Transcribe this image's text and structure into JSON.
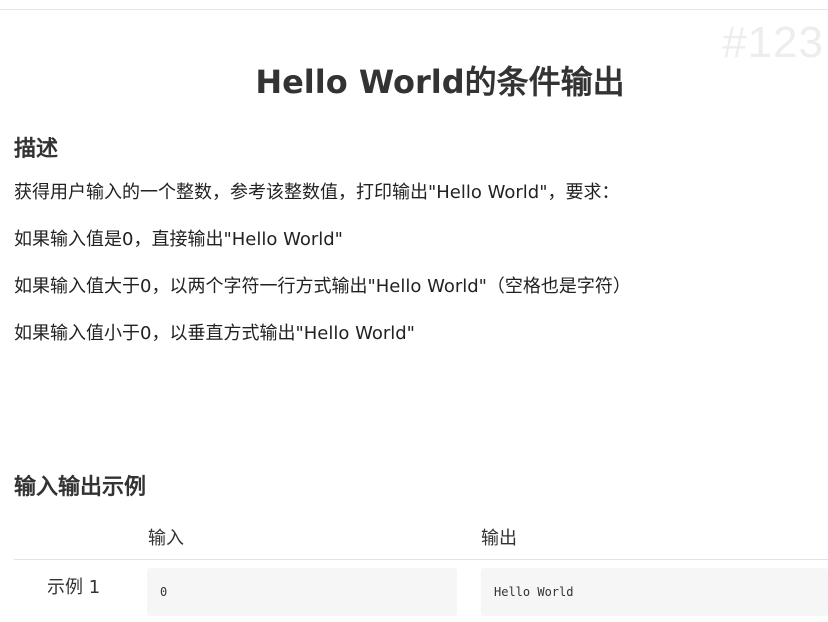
{
  "watermark": "#123",
  "title": "Hello World的条件输出",
  "description": {
    "heading": "描述",
    "lines": [
      "获得用户输入的一个整数，参考该整数值，打印输出\"Hello World\"，要求：",
      "如果输入值是0，直接输出\"Hello World\"",
      "如果输入值大于0，以两个字符一行方式输出\"Hello World\"（空格也是字符）",
      "如果输入值小于0，以垂直方式输出\"Hello World\""
    ]
  },
  "examples": {
    "heading": "输入输出示例",
    "input_header": "输入",
    "output_header": "输出",
    "rows": [
      {
        "label": "示例 1",
        "input": "0",
        "output": "Hello World"
      }
    ]
  }
}
